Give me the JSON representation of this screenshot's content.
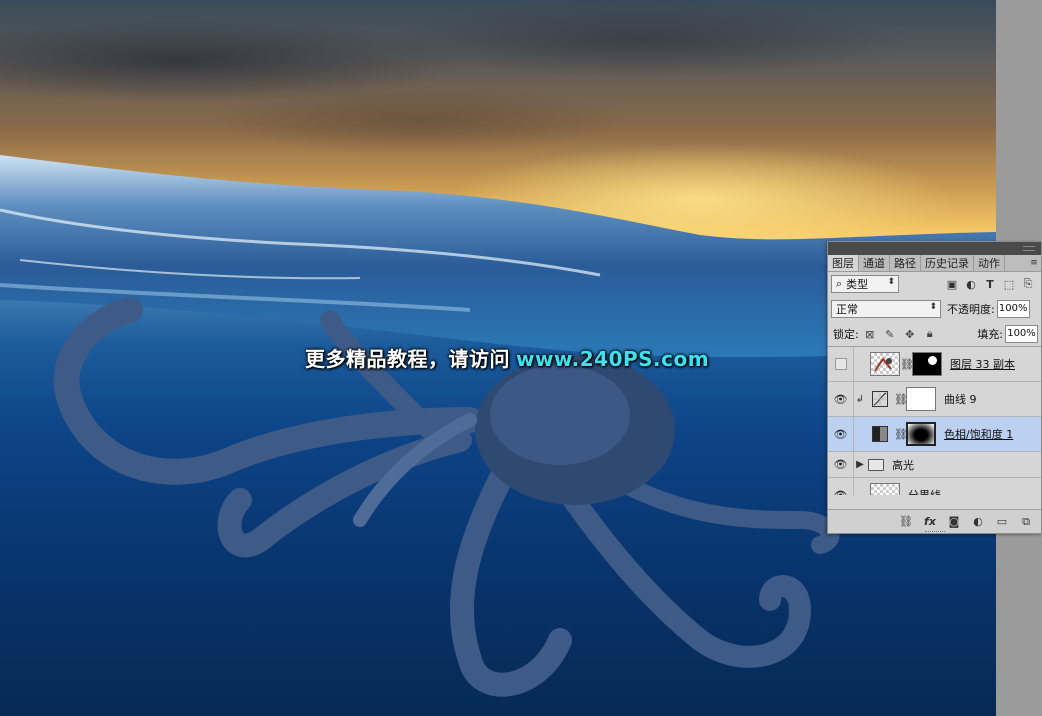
{
  "watermark": {
    "cn": "更多精品教程，请访问",
    "url": "www.240PS.com"
  },
  "layers_panel": {
    "tabs": [
      "图层",
      "通道",
      "路径",
      "历史记录",
      "动作"
    ],
    "active_tab": "图层",
    "filter": {
      "label": "类型",
      "icon": "search-icon"
    },
    "filter_icons": [
      "image-filter-icon",
      "adjustment-filter-icon",
      "T",
      "shape-filter-icon",
      "smart-object-filter-icon"
    ],
    "blend_mode": "正常",
    "opacity_label": "不透明度:",
    "opacity_value": "100%",
    "lock_label": "锁定:",
    "fill_label": "填充:",
    "fill_value": "100%",
    "layers": [
      {
        "name": "图层 33 副本",
        "visible": false,
        "type": "pixel-with-mask",
        "selected": false
      },
      {
        "name": "曲线 9",
        "visible": true,
        "type": "curves-adjustment",
        "clipped": true,
        "selected": false
      },
      {
        "name": "色相/饱和度 1",
        "visible": true,
        "type": "hue-saturation-adjustment",
        "selected": true
      },
      {
        "name": "高光",
        "visible": true,
        "type": "group",
        "selected": false
      },
      {
        "name": "分界线",
        "visible": true,
        "type": "pixel",
        "selected": false
      }
    ],
    "bottom_icons": [
      "link-icon",
      "fx",
      "mask-icon",
      "adjustment-icon",
      "folder-icon",
      "new-layer-icon"
    ],
    "colors": {
      "panel_bg": "#d6d6d6",
      "selected_row": "#bcd0f2",
      "topbar": "#4a4a4a"
    }
  }
}
